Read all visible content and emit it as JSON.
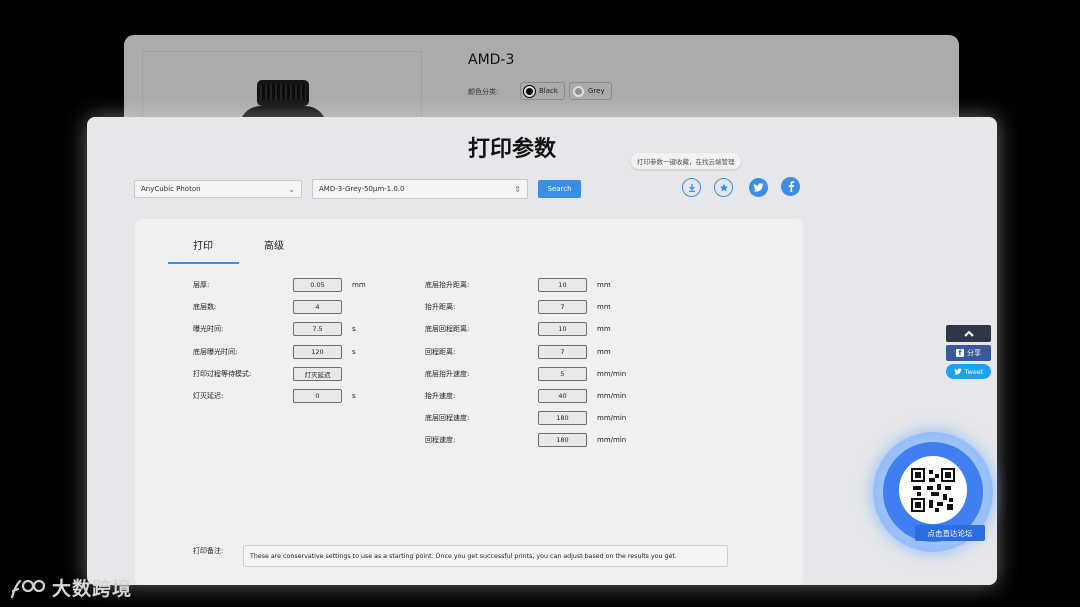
{
  "background_card": {
    "title": "AMD-3",
    "color_label": "颜色分类:",
    "swatches": [
      "Black",
      "Grey"
    ]
  },
  "modal": {
    "title": "打印参数",
    "tooltip": "打印参数一键收藏，在找云端管理",
    "printer_select": "AnyCubic Photon",
    "profile_select": "AMD-3-Grey-50µm-1.0.0",
    "search_label": "Search",
    "icons": [
      "download-icon",
      "star-icon",
      "twitter-icon",
      "facebook-icon"
    ]
  },
  "tabs": [
    "打印",
    "高级"
  ],
  "left_fields": [
    {
      "label": "层厚:",
      "value": "0.05",
      "unit": "mm"
    },
    {
      "label": "底层数:",
      "value": "4",
      "unit": ""
    },
    {
      "label": "曝光时间:",
      "value": "7.5",
      "unit": "s"
    },
    {
      "label": "底层曝光时间:",
      "value": "120",
      "unit": "s"
    },
    {
      "label": "打印过程等待模式:",
      "value": "灯灭延迟",
      "unit": ""
    },
    {
      "label": "灯灭延迟:",
      "value": "0",
      "unit": "s"
    }
  ],
  "right_fields": [
    {
      "label": "底层抬升距离:",
      "value": "10",
      "unit": "mm"
    },
    {
      "label": "抬升距离:",
      "value": "7",
      "unit": "mm"
    },
    {
      "label": "底层回程距离:",
      "value": "10",
      "unit": "mm"
    },
    {
      "label": "回程距离:",
      "value": "7",
      "unit": "mm"
    },
    {
      "label": "底层抬升速度:",
      "value": "5",
      "unit": "mm/min"
    },
    {
      "label": "抬升速度:",
      "value": "40",
      "unit": "mm/min"
    },
    {
      "label": "底层回程速度:",
      "value": "180",
      "unit": "mm/min"
    },
    {
      "label": "回程速度:",
      "value": "180",
      "unit": "mm/min"
    }
  ],
  "notes": {
    "label": "打印备注:",
    "text": "These are conservative settings to use as a starting point. Once you get successful prints, you can adjust based on the results you get."
  },
  "side_widgets": {
    "share_label": "分享",
    "tweet_label": "Tweet",
    "qr_label": "点击直达论坛"
  },
  "watermark": "大数跨境",
  "colors": {
    "accent": "#3a8ee6",
    "facebook": "#3b5998",
    "twitter": "#1da1f2"
  }
}
